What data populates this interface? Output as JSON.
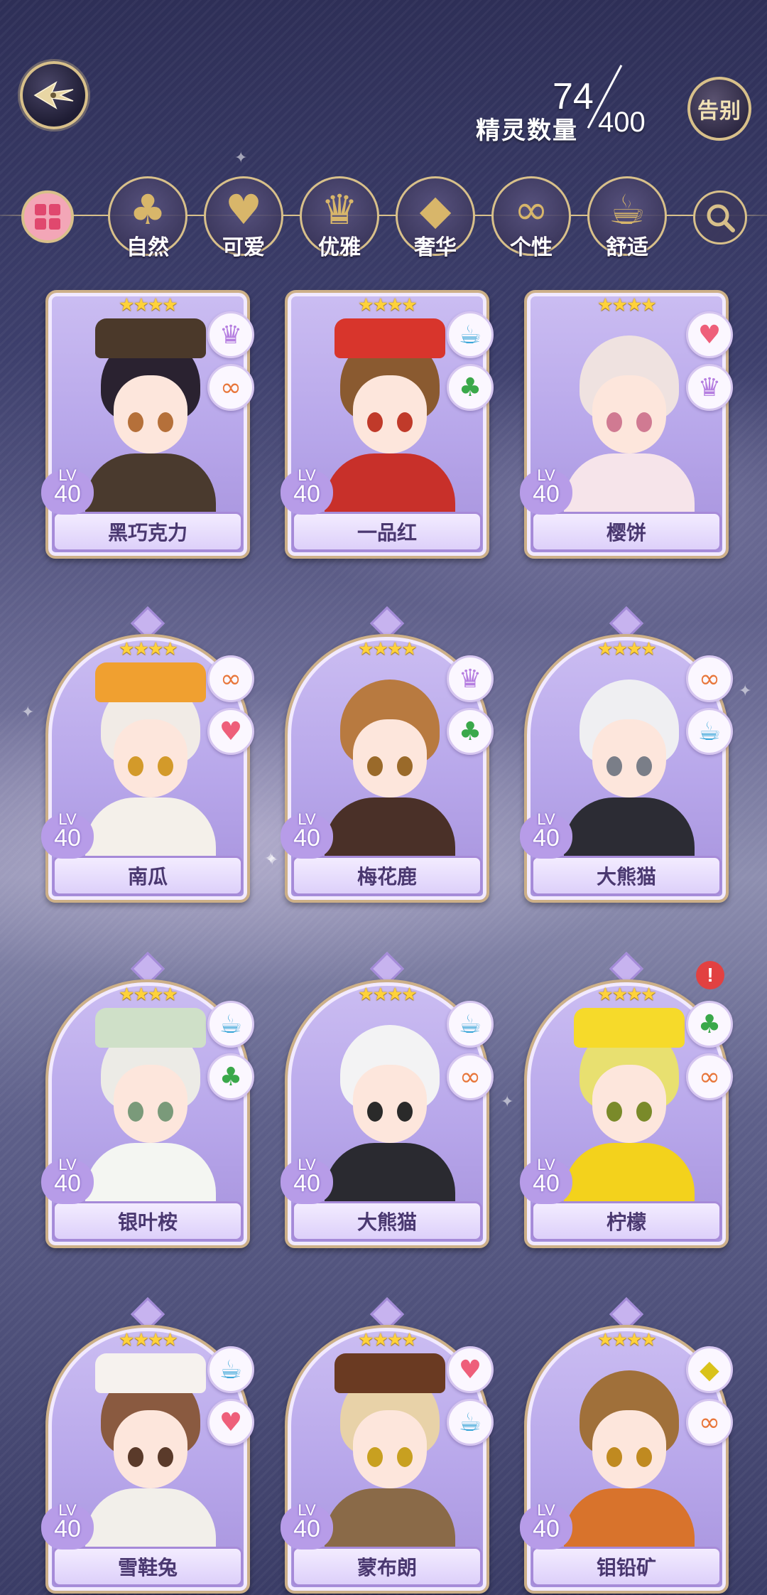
{
  "header": {
    "count_label": "精灵数量",
    "count_current": "74",
    "count_max": "400",
    "farewell_label": "告别"
  },
  "filters": [
    {
      "label": "自然",
      "icon": "clover-icon",
      "glyph": "♣"
    },
    {
      "label": "可爱",
      "icon": "heart-icon",
      "glyph": "♥"
    },
    {
      "label": "优雅",
      "icon": "swan-icon",
      "glyph": "♛"
    },
    {
      "label": "奢华",
      "icon": "diamond-icon",
      "glyph": "◆"
    },
    {
      "label": "个性",
      "icon": "glasses-icon",
      "glyph": "∞"
    },
    {
      "label": "舒适",
      "icon": "teacup-icon",
      "glyph": "☕"
    }
  ],
  "spirits": [
    {
      "name": "黑巧克力",
      "level_label": "LV",
      "level": "40",
      "stars": "★★★★",
      "badges": [
        "swan-icon",
        "glasses-icon"
      ],
      "hair": "#2a2230",
      "eye": "#b5703a",
      "outfit": "#4a3a2e",
      "hat": "#4b392a"
    },
    {
      "name": "一品红",
      "level_label": "LV",
      "level": "40",
      "stars": "★★★★",
      "badges": [
        "teacup-icon",
        "clover-icon"
      ],
      "hair": "#8a5a30",
      "eye": "#c03a2a",
      "outfit": "#c8302a",
      "hat": "#d8352c"
    },
    {
      "name": "樱饼",
      "level_label": "LV",
      "level": "40",
      "stars": "★★★★",
      "badges": [
        "heart-icon",
        "swan-icon"
      ],
      "hair": "#efe2e0",
      "eye": "#d07a92",
      "outfit": "#f6e4ea",
      "hat": ""
    },
    {
      "name": "南瓜",
      "level_label": "LV",
      "level": "40",
      "stars": "★★★★",
      "badges": [
        "glasses-icon",
        "heart-icon"
      ],
      "hair": "#f1ebe6",
      "eye": "#d39a2a",
      "outfit": "#f4f0ea",
      "hat": "#f0a030"
    },
    {
      "name": "梅花鹿",
      "level_label": "LV",
      "level": "40",
      "stars": "★★★★",
      "badges": [
        "swan-icon",
        "clover-icon"
      ],
      "hair": "#b87a40",
      "eye": "#9a6a2a",
      "outfit": "#4a3028",
      "hat": ""
    },
    {
      "name": "大熊猫",
      "level_label": "LV",
      "level": "40",
      "stars": "★★★★",
      "badges": [
        "glasses-icon",
        "teacup-icon"
      ],
      "hair": "#efeff2",
      "eye": "#7a7e88",
      "outfit": "#2c2c34",
      "hat": ""
    },
    {
      "name": "银叶桉",
      "level_label": "LV",
      "level": "40",
      "stars": "★★★★",
      "badges": [
        "teacup-icon",
        "clover-icon"
      ],
      "hair": "#ecebe6",
      "eye": "#7a9a7a",
      "outfit": "#f4f6f2",
      "hat": "#cfe0c8"
    },
    {
      "name": "大熊猫",
      "level_label": "LV",
      "level": "40",
      "stars": "★★★★",
      "badges": [
        "teacup-icon",
        "glasses-icon"
      ],
      "hair": "#f3f3f4",
      "eye": "#2a2a2a",
      "outfit": "#2a2a30",
      "hat": ""
    },
    {
      "name": "柠檬",
      "level_label": "LV",
      "level": "40",
      "stars": "★★★★",
      "badges": [
        "clover-icon",
        "glasses-icon"
      ],
      "hair": "#e8e070",
      "eye": "#7a8a2a",
      "outfit": "#f3d21c",
      "hat": "#f6da2a",
      "alert": "!"
    },
    {
      "name": "雪鞋兔",
      "level_label": "LV",
      "level": "40",
      "stars": "★★★★",
      "badges": [
        "teacup-icon",
        "heart-icon"
      ],
      "hair": "#8a5a40",
      "eye": "#5a3a2a",
      "outfit": "#f2efea",
      "hat": "#f6f2ee"
    },
    {
      "name": "蒙布朗",
      "level_label": "LV",
      "level": "40",
      "stars": "★★★★",
      "badges": [
        "heart-icon",
        "teacup-icon"
      ],
      "hair": "#e8d2a8",
      "eye": "#c8a020",
      "outfit": "#8a6a48",
      "hat": "#6a3a22"
    },
    {
      "name": "钼铅矿",
      "level_label": "LV",
      "level": "40",
      "stars": "★★★★",
      "badges": [
        "diamond-icon",
        "glasses-icon"
      ],
      "hair": "#a0703a",
      "eye": "#c08a20",
      "outfit": "#d8732c",
      "hat": ""
    }
  ],
  "badge_glyphs": {
    "swan-icon": {
      "glyph": "♛",
      "color": "#b57ee0"
    },
    "glasses-icon": {
      "glyph": "∞",
      "color": "#e8763a"
    },
    "teacup-icon": {
      "glyph": "☕",
      "color": "#3aa6d8"
    },
    "clover-icon": {
      "glyph": "♣",
      "color": "#3aa84a"
    },
    "heart-icon": {
      "glyph": "♥",
      "color": "#ee5f7a"
    },
    "diamond-icon": {
      "glyph": "◆",
      "color": "#d9c21a"
    }
  },
  "colors": {
    "gold": "#d8c08a",
    "card_purple": "#b7a6ea",
    "name_text": "#4a3870"
  }
}
